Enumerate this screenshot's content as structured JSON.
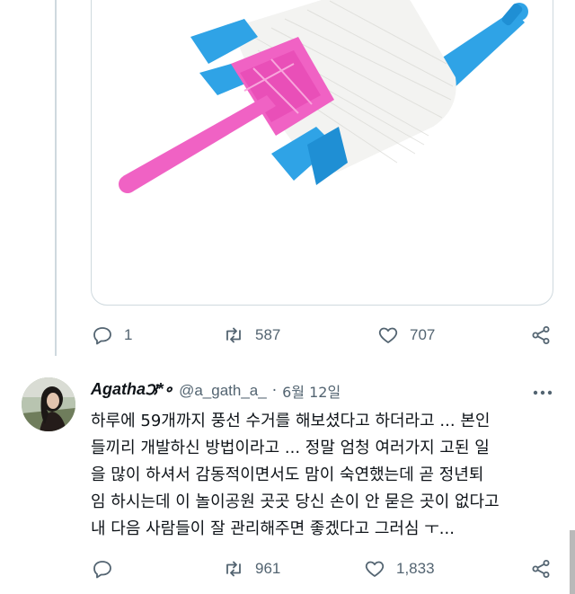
{
  "top_tweet": {
    "stats": {
      "replies": "1",
      "retweets": "587",
      "likes": "707"
    }
  },
  "reply": {
    "display_name": "Agatha౫*∘",
    "handle": "@a_gath_a_",
    "separator": "·",
    "date": "6월 12일",
    "text_lines": [
      "하루에 59개까지 풍선 수거를 해보셨다고 하더라고 ... 본인",
      "들끼리 개발하신 방법이라고 ... 정말 엄청 여러가지 고된 일",
      "을 많이 하셔서 감동적이면서도 맘이 숙연했는데 곧 정년퇴",
      "임 하시는데 이 놀이공원 곳곳 당신 손이 안 묻은 곳이 없다고",
      "내 다음 사람들이 잘 관리해주면 좋겠다고 그러심 ㅜ..."
    ],
    "stats": {
      "replies": "",
      "retweets": "961",
      "likes": "1,833"
    }
  },
  "icons": {
    "reply": "reply-icon",
    "retweet": "retweet-icon",
    "like": "heart-icon",
    "share": "share-icon",
    "more": "more-options-icon"
  },
  "colors": {
    "text_primary": "#0f1419",
    "text_secondary": "#536471",
    "border": "#cfd9de",
    "spool_blue": "#2fa3e6",
    "spool_pink": "#f062c4"
  }
}
